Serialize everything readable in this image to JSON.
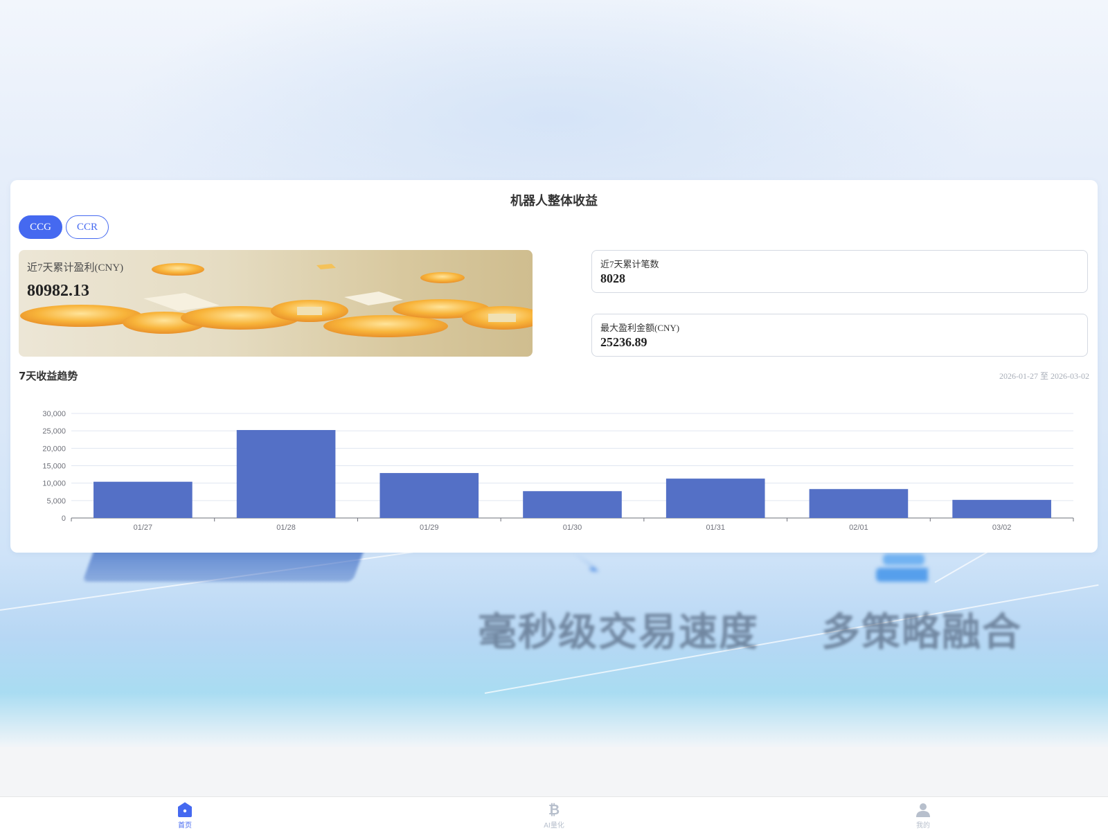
{
  "background": {
    "slogans": [
      "毫秒级交易速度",
      "多策略融合"
    ]
  },
  "card": {
    "title": "机器人整体收益",
    "tabs": [
      {
        "label": "CCG",
        "active": true
      },
      {
        "label": "CCR",
        "active": false
      }
    ],
    "banner": {
      "label": "近7天累计盈利(CNY)",
      "value": "80982.13"
    },
    "stats": [
      {
        "label": "近7天累计笔数",
        "value": "8028"
      },
      {
        "label": "最大盈利金额(CNY)",
        "value": "25236.89"
      }
    ],
    "trend_title": "7天收益趋势",
    "date_range": "2026-01-27 至 2026-03-02"
  },
  "chart_data": {
    "type": "bar",
    "categories": [
      "01/27",
      "01/28",
      "01/29",
      "01/30",
      "01/31",
      "02/01",
      "03/02"
    ],
    "values": [
      10400,
      25236.89,
      12900,
      7700,
      11300,
      8300,
      5200
    ],
    "ylim": [
      0,
      30000
    ],
    "yticks": [
      "30,000",
      "25,000",
      "20,000",
      "15,000",
      "10,000",
      "5,000",
      "0"
    ],
    "grid": true,
    "bar_color": "#5470c6"
  },
  "nav": {
    "items": [
      {
        "label": "首页",
        "icon": "home-icon",
        "active": true
      },
      {
        "label": "AI量化",
        "icon": "bitcoin-icon",
        "active": false
      },
      {
        "label": "我的",
        "icon": "user-icon",
        "active": false
      }
    ]
  },
  "colors": {
    "accent": "#4569f0",
    "nav_inactive": "#b7bfcc"
  }
}
